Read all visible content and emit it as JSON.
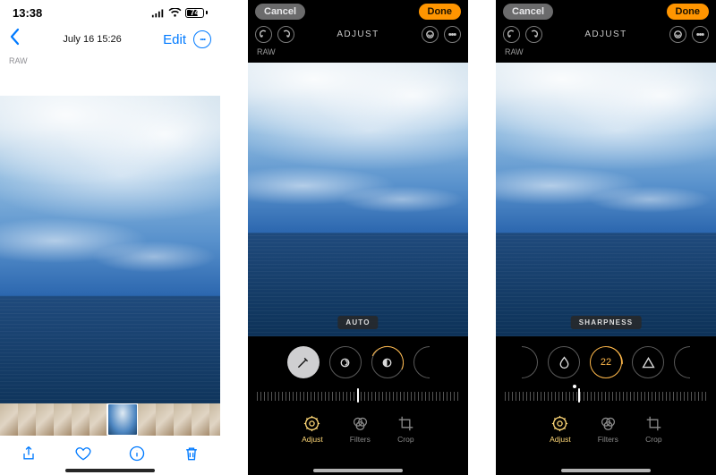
{
  "viewer": {
    "status_time": "13:38",
    "battery_pct": "74",
    "date_line": "July 16  15:26",
    "edit_label": "Edit",
    "raw_badge": "RAW"
  },
  "editor_common": {
    "cancel_label": "Cancel",
    "done_label": "Done",
    "mode_title": "ADJUST",
    "raw_badge": "RAW",
    "tabs": {
      "adjust": "Adjust",
      "filters": "Filters",
      "crop": "Crop"
    }
  },
  "editor_a": {
    "param_label": "AUTO"
  },
  "editor_b": {
    "param_label": "SHARPNESS",
    "param_value": "22"
  }
}
